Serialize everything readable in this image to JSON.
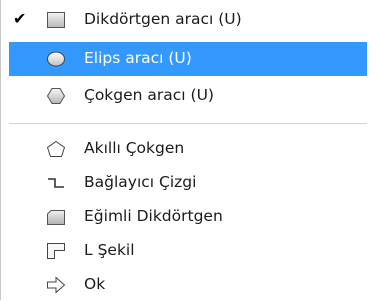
{
  "menu": {
    "items": [
      {
        "label": "Dikdörtgen aracı (U)",
        "icon": "rectangle-tool-icon",
        "checked": true
      },
      {
        "label": "Elips aracı (U)",
        "icon": "ellipse-tool-icon",
        "selected": true
      },
      {
        "label": "Çokgen aracı (U)",
        "icon": "polygon-tool-icon"
      },
      {
        "label": "Akıllı Çokgen",
        "icon": "smart-polygon-icon"
      },
      {
        "label": "Bağlayıcı Çizgi",
        "icon": "connector-line-icon"
      },
      {
        "label": "Eğimli Dikdörtgen",
        "icon": "beveled-rectangle-icon"
      },
      {
        "label": "L Şekil",
        "icon": "l-shape-icon"
      },
      {
        "label": "Ok",
        "icon": "arrow-shape-icon"
      }
    ],
    "check_mark": "✔",
    "colors": {
      "highlight": "#3399ff",
      "highlight_text": "#ffffff",
      "text": "#1b1b1b"
    }
  }
}
